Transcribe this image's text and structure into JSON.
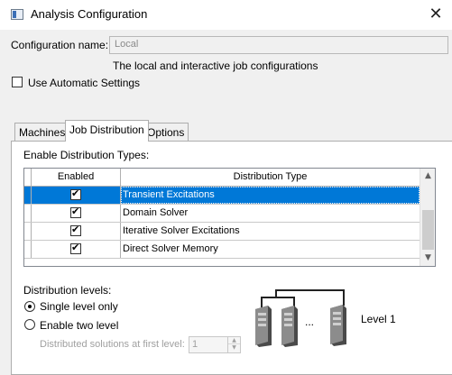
{
  "window": {
    "title": "Analysis Configuration",
    "close_glyph": "✕"
  },
  "config": {
    "name_label": "Configuration name:",
    "name_value": "Local",
    "description": "The local and interactive job configurations",
    "auto_settings_label": "Use Automatic Settings",
    "auto_settings_checked": false
  },
  "tabs": [
    {
      "label": "Machines",
      "active": false
    },
    {
      "label": "Job Distribution",
      "active": true
    },
    {
      "label": "Options",
      "active": false
    }
  ],
  "distribution": {
    "section_label": "Enable Distribution Types:",
    "columns": [
      "Enabled",
      "Distribution Type"
    ],
    "rows": [
      {
        "enabled": true,
        "type": "Transient Excitations",
        "selected": true
      },
      {
        "enabled": true,
        "type": "Domain Solver",
        "selected": false
      },
      {
        "enabled": true,
        "type": "Iterative Solver Excitations",
        "selected": false
      },
      {
        "enabled": true,
        "type": "Direct Solver Memory",
        "selected": false
      }
    ]
  },
  "levels": {
    "label": "Distribution levels:",
    "single_label": "Single level only",
    "two_label": "Enable two level",
    "selected": "single",
    "first_level_label": "Distributed solutions at first level:",
    "first_level_value": "1"
  },
  "diagram": {
    "ellipsis": "...",
    "level_label": "Level 1"
  },
  "icons": {
    "app": "app-window-icon",
    "close": "close-icon",
    "scroll_up": "scroll-up-icon",
    "scroll_down": "scroll-down-icon",
    "server": "server-icon"
  },
  "colors": {
    "selection": "#0078d7",
    "dialog_bg": "#f0f0f0"
  }
}
